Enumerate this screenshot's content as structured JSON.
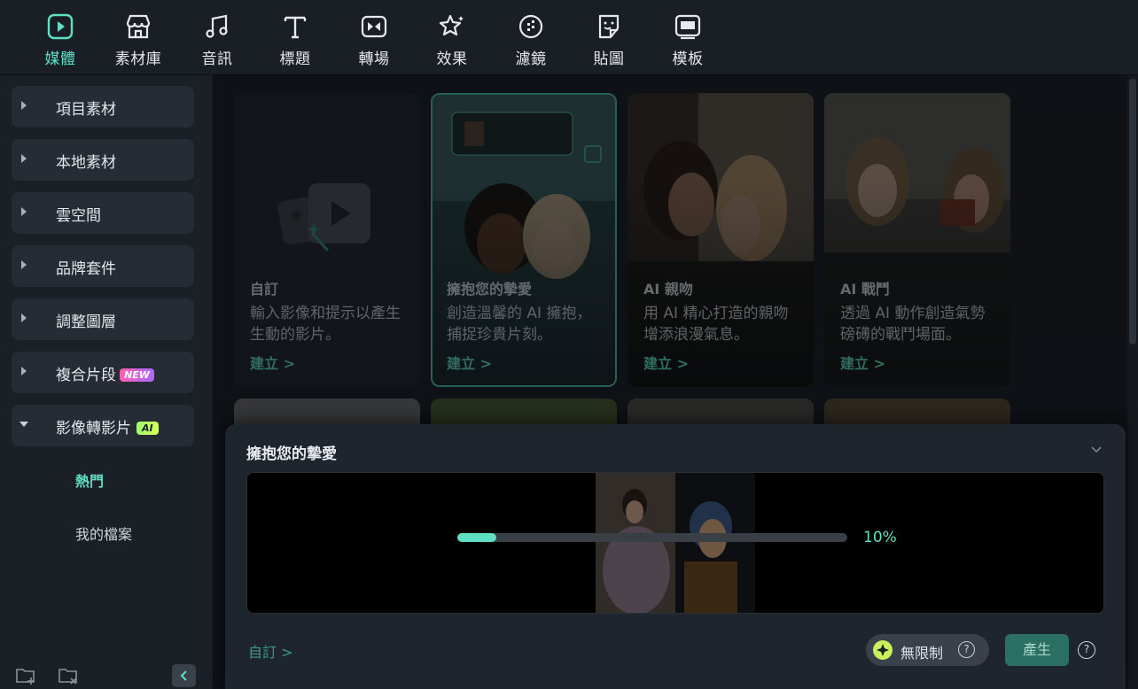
{
  "toolbar": {
    "items": [
      {
        "label": "媒體",
        "icon": "media-icon",
        "active": true
      },
      {
        "label": "素材庫",
        "icon": "store-icon"
      },
      {
        "label": "音訊",
        "icon": "music-icon"
      },
      {
        "label": "標題",
        "icon": "text-icon"
      },
      {
        "label": "轉場",
        "icon": "transition-icon"
      },
      {
        "label": "效果",
        "icon": "effects-icon"
      },
      {
        "label": "濾鏡",
        "icon": "filter-icon"
      },
      {
        "label": "貼圖",
        "icon": "sticker-icon"
      },
      {
        "label": "模板",
        "icon": "template-icon"
      }
    ]
  },
  "sidebar": {
    "items": [
      {
        "label": "項目素材"
      },
      {
        "label": "本地素材"
      },
      {
        "label": "雲空間"
      },
      {
        "label": "品牌套件"
      },
      {
        "label": "調整圖層"
      },
      {
        "label": "複合片段",
        "badge": "NEW"
      },
      {
        "label": "影像轉影片",
        "badge": "AI",
        "expanded": true
      }
    ],
    "sub_items": [
      {
        "label": "熱門",
        "active": true
      },
      {
        "label": "我的檔案"
      }
    ]
  },
  "cards": [
    {
      "title": "自訂",
      "desc": "輸入影像和提示以產生生動的影片。",
      "button": "建立 >"
    },
    {
      "title": "擁抱您的摯愛",
      "desc": "創造溫馨的 AI 擁抱，捕捉珍貴片刻。",
      "button": "建立 >"
    },
    {
      "title": "AI 親吻",
      "desc": "用 AI 精心打造的親吻增添浪漫氣息。",
      "button": "建立 >"
    },
    {
      "title": "AI 戰鬥",
      "desc": "透過 AI 動作創造氣勢磅礡的戰鬥場面。",
      "button": "建立 >"
    }
  ],
  "modal": {
    "title": "擁抱您的摯愛",
    "progress_percent": 10,
    "progress_text": "10%",
    "custom_link": "自訂 >",
    "unlimited_label": "無限制",
    "help_glyph": "?",
    "generate_label": "產生"
  },
  "colors": {
    "accent": "#5fe0c2",
    "panel": "#1f252d",
    "sidebar": "#1b2027"
  }
}
